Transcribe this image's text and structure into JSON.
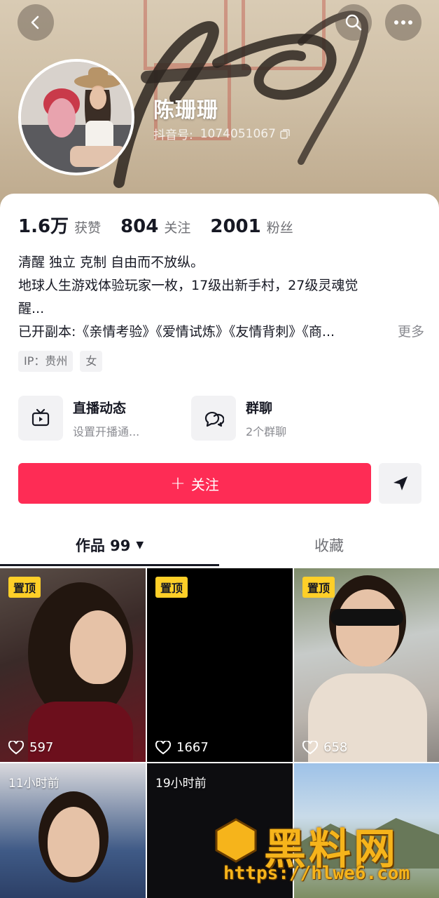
{
  "profile": {
    "nickname": "陈珊珊",
    "douyin_id_label": "抖音号:",
    "douyin_id": "1074051067"
  },
  "stats": [
    {
      "value": "1.6万",
      "label": "获赞"
    },
    {
      "value": "804",
      "label": "关注"
    },
    {
      "value": "2001",
      "label": "粉丝"
    }
  ],
  "bio": {
    "line1": "清醒 独立 克制 自由而不放纵。",
    "line2": "地球人生游戏体验玩家一枚，17级出新手村，27级灵魂觉",
    "line3": "醒...",
    "line4": "已开副本:《亲情考验》《爱情试炼》《友情背刺》《商...",
    "more": "更多"
  },
  "tags": [
    "IP：贵州",
    "女"
  ],
  "features": {
    "live": {
      "title": "直播动态",
      "subtitle": "设置开播通..."
    },
    "group": {
      "title": "群聊",
      "subtitle": "2个群聊"
    }
  },
  "actions": {
    "follow_plus": "+",
    "follow_label": "关注"
  },
  "tabs": {
    "works": "作品 99",
    "favorites": "收藏"
  },
  "videos": [
    {
      "badge": "置顶",
      "likes": "597"
    },
    {
      "badge": "置顶",
      "likes": "1667"
    },
    {
      "badge": "置顶",
      "likes": "658"
    },
    {
      "time": "11小时前"
    },
    {
      "time": "19小时前"
    },
    {}
  ],
  "watermark": {
    "logo_text": "黑料网",
    "url": "https://hlwe6.com",
    "mark": "HL"
  },
  "colors": {
    "primary": "#fe2c55",
    "pin_badge": "#fecf28",
    "watermark": "#f6b41b"
  }
}
